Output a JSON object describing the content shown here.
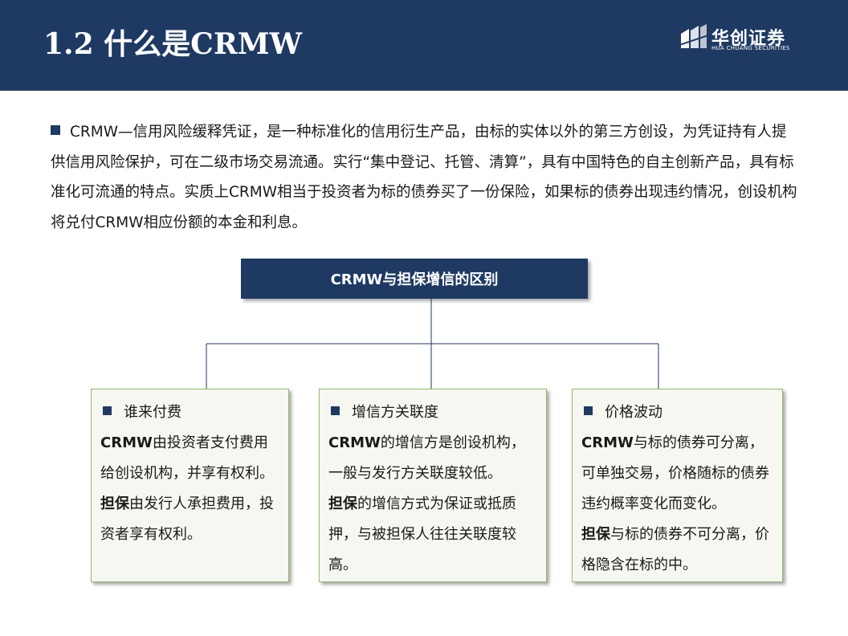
{
  "header": {
    "title": "1.2 什么是CRMW",
    "logo_cn": "华创证券",
    "logo_en": "HUA CHUANG SECURITIES"
  },
  "intro": {
    "text": "CRMW—信用风险缓释凭证，是一种标准化的信用衍生产品，由标的实体以外的第三方创设，为凭证持有人提供信用风险保护，可在二级市场交易流通。实行“集中登记、托管、清算”，具有中国特色的自主创新产品，具有标准化可流通的特点。实质上CRMW相当于投资者为标的债券买了一份保险，如果标的债券出现违约情况，创设机构将兑付CRMW相应份额的本金和利息。"
  },
  "diagram": {
    "root_label": "CRMW与担保增信的区别",
    "cards": [
      {
        "title": "谁来付费",
        "p1_lead": "CRMW",
        "p1_text": "由投资者支付费用给创设机构，并享有权利。",
        "p2_lead": "担保",
        "p2_text": "由发行人承担费用，投资者享有权利。"
      },
      {
        "title": "增信方关联度",
        "p1_lead": "CRMW",
        "p1_text": "的增信方是创设机构，一般与发行方关联度较低。",
        "p2_lead": "担保",
        "p2_text": "的增信方式为保证或抵质押，与被担保人往往关联度较高。"
      },
      {
        "title": "价格波动",
        "p1_lead": "CRMW",
        "p1_text": "与标的债券可分离，可单独交易，价格随标的债券违约概率变化而变化。",
        "p2_lead": "担保",
        "p2_text": "与标的债券不可分离，价格隐含在标的中。"
      }
    ]
  },
  "colors": {
    "navy": "#1e3a63",
    "card_border": "#8fbf6a",
    "card_bg": "#f6f7f1"
  }
}
